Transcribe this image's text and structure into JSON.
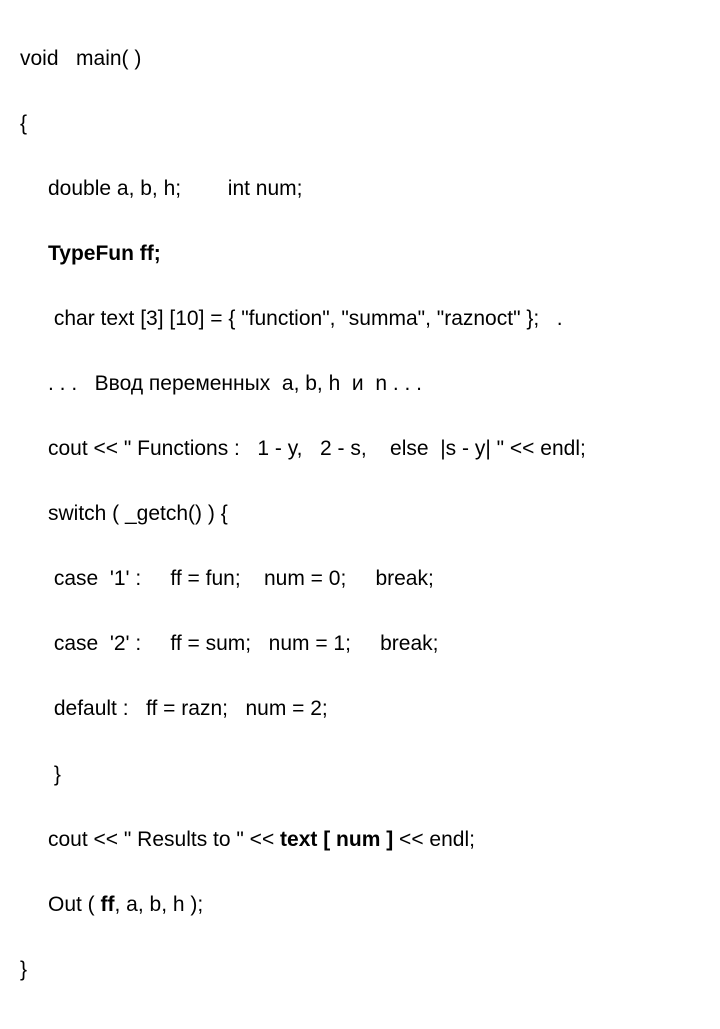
{
  "code": {
    "l1": "void   main( )",
    "l2": "{",
    "l3_a": "double a, b, h;        int num;",
    "l4_a": "TypeFun ff;",
    "l5_a": " char text [3] [10] = { \"function\", \"summa\", \"raznoct\" };   .",
    "l6_a": ". . .   Ввод переменных  a, b, h  и  n . . .",
    "l7_a": "cout << \" Functions :   1 - y,   2 - s,    else  |s - y| \" << endl;",
    "l8_a": "switch ( _getch() ) {",
    "l9_a": " case  '1' :     ff = fun;    num = 0;     break;",
    "l10_a": " case  '2' :     ff = sum;   num = 1;     break;",
    "l11_a": " default :   ff = razn;   num = 2;",
    "l12_a": " }",
    "l13_a_pre": "cout << \" Results to \" << ",
    "l13_a_bold": "text [ num ]",
    "l13_a_post": " << endl;",
    "l14_a_pre": "Out ( ",
    "l14_a_bold": "ff",
    "l14_a_post": ", a, b, h );",
    "l15": "}"
  }
}
